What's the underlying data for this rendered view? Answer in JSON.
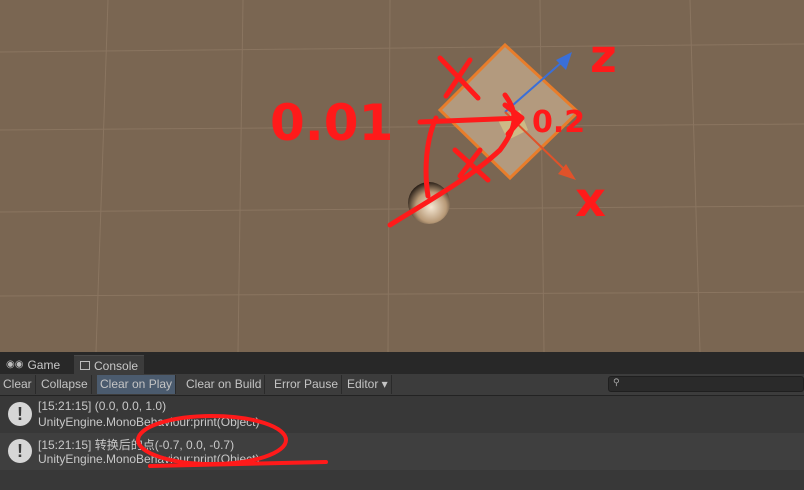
{
  "tabs": [
    {
      "label": "Game",
      "icon": "gamepad-icon"
    },
    {
      "label": "Console",
      "icon": "console-icon"
    }
  ],
  "toolbar": {
    "clear": "Clear",
    "collapse": "Collapse",
    "clear_on_play": "Clear on Play",
    "clear_on_build": "Clear on Build",
    "error_pause": "Error Pause",
    "editor": "Editor ▾"
  },
  "logs": [
    {
      "time_text": "[15:21:15] (0.0, 0.0, 1.0)",
      "source": "UnityEngine.MonoBehaviour:print(Object)"
    },
    {
      "time_text": "[15:21:15] 转换后的点(-0.7, 0.0, -0.7)",
      "source": "UnityEngine.MonoBehaviour:print(Object)"
    }
  ],
  "annotations": {
    "scale_text": "0.01",
    "z_label": "z",
    "x_label": "x",
    "near_label": "0.2"
  },
  "colors": {
    "ground": "#7a6652",
    "selection": "#e87d2b",
    "ink": "#ff1a1a",
    "axis_blue": "#3a6fd8",
    "axis_red": "#e0522a"
  }
}
